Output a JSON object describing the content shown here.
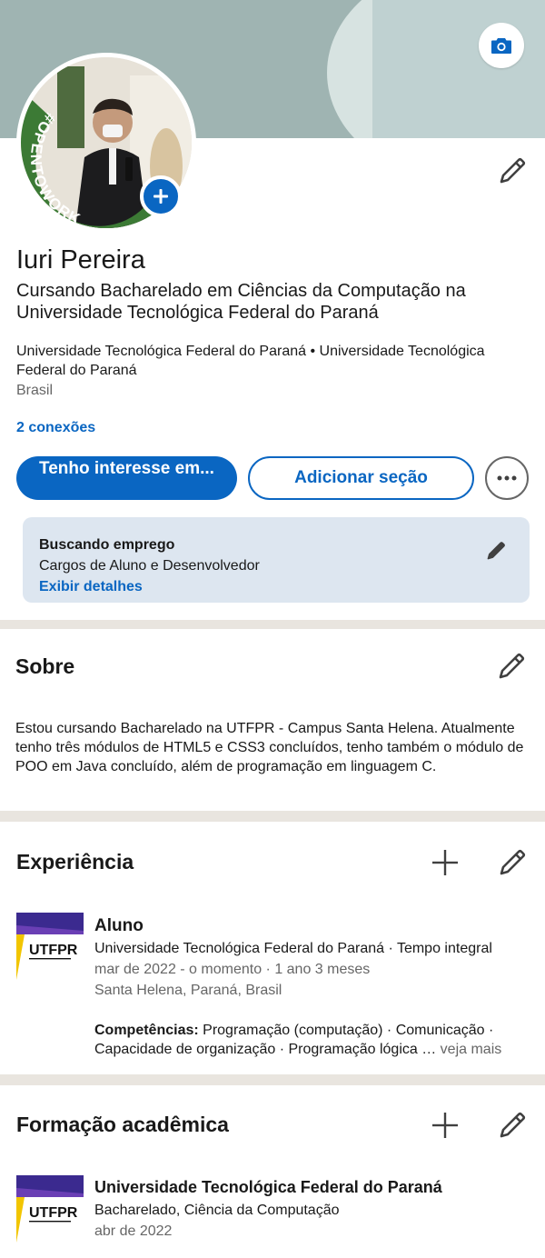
{
  "profile": {
    "name": "Iuri Pereira",
    "headline": "Cursando Bacharelado em Ciências da Computação na Universidade Tecnológica Federal do Paraná",
    "education_line": "Universidade Tecnológica Federal do Paraná • Universidade Tecnológica Federal do Paraná",
    "location": "Brasil",
    "connections": "2 conexões",
    "open_to_work_badge": "#OPENTOWORK"
  },
  "actions": {
    "primary": "Tenho interesse em...",
    "secondary": "Adicionar seção"
  },
  "job_seeking": {
    "title": "Buscando emprego",
    "roles": "Cargos de Aluno e Desenvolvedor",
    "link": "Exibir detalhes"
  },
  "about": {
    "title": "Sobre",
    "text": "Estou cursando Bacharelado na UTFPR - Campus Santa Helena. Atualmente tenho três módulos de HTML5 e CSS3 concluídos, tenho também o módulo de POO em Java concluído, além de programação em linguagem C."
  },
  "experience": {
    "title": "Experiência",
    "items": [
      {
        "role": "Aluno",
        "company": "Universidade Tecnológica Federal do Paraná · Tempo integral",
        "period": "mar de 2022 - o momento · 1 ano 3 meses",
        "location": "Santa Helena, Paraná, Brasil",
        "skills_label": "Competências:",
        "skills": "Programação (computação) · Comunicação · Capacidade de organização · Programação lógica …",
        "see_more": "veja mais",
        "logo_text": "UTFPR"
      }
    ]
  },
  "education": {
    "title": "Formação acadêmica",
    "items": [
      {
        "school": "Universidade Tecnológica Federal do Paraná",
        "degree": "Bacharelado, Ciência da Computação",
        "date": "abr de 2022",
        "logo_text": "UTFPR"
      }
    ]
  },
  "colors": {
    "accent": "#0a66c2",
    "open_to_work_ring": "#3c7a35",
    "divider": "#e9e5df",
    "job_card_bg": "#dde6f0"
  },
  "icons": {
    "cover_camera": "camera-icon",
    "add_photo": "plus-icon",
    "edit": "pencil-icon",
    "add": "plus-icon",
    "more": "ellipsis-icon"
  }
}
